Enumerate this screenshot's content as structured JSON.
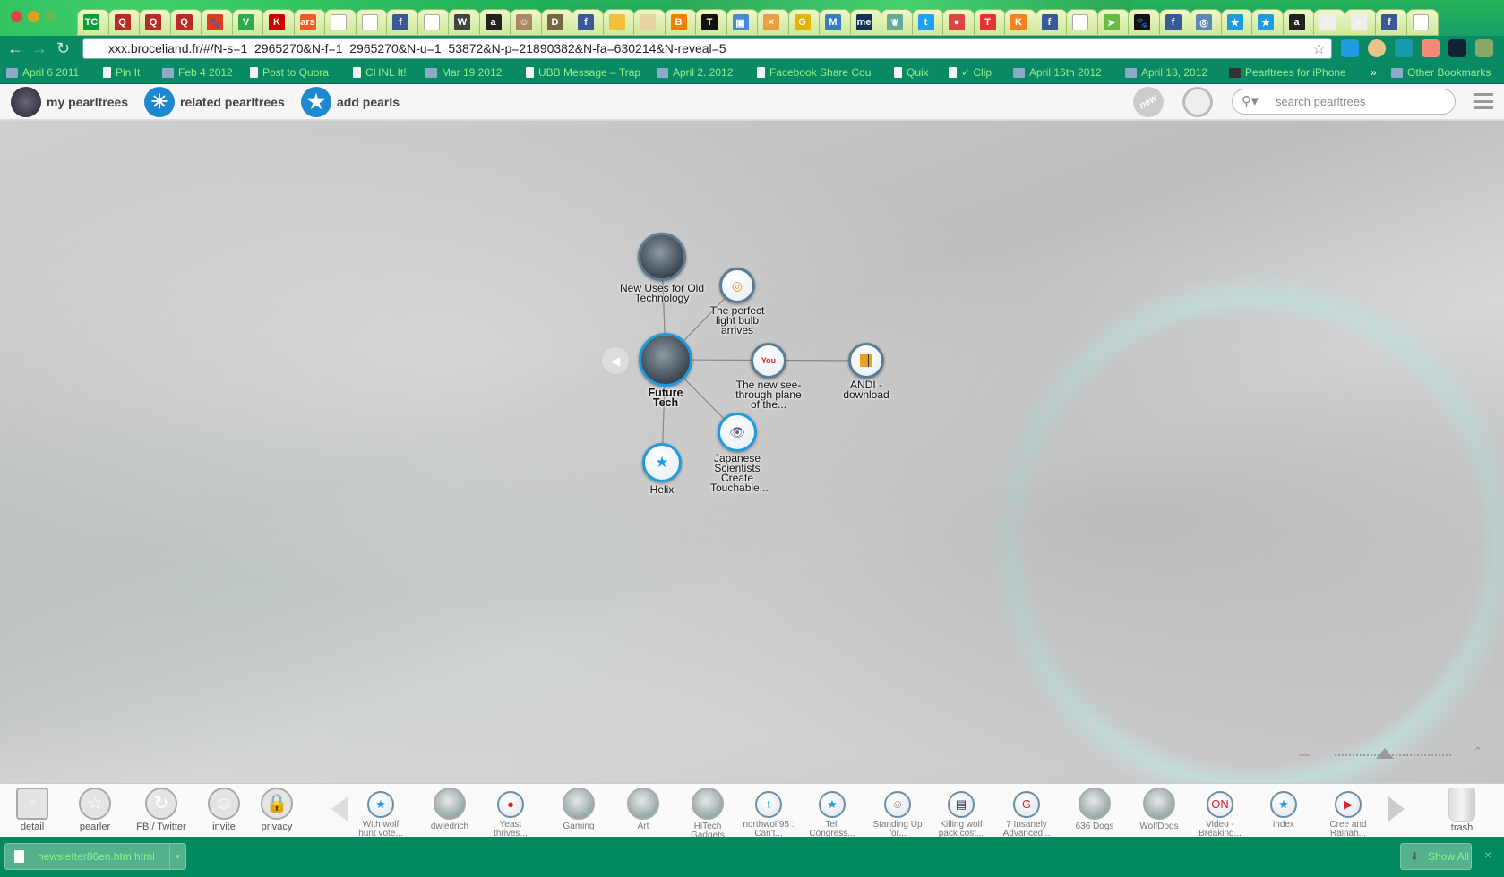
{
  "browser": {
    "tabs": [
      {
        "icon": "TC",
        "color": "#0a9d3a"
      },
      {
        "icon": "Q",
        "color": "#b92b27"
      },
      {
        "icon": "Q",
        "color": "#b92b27"
      },
      {
        "icon": "Q",
        "color": "#b92b27"
      },
      {
        "icon": "paw",
        "color": "#e03c1e"
      },
      {
        "icon": "V",
        "color": "#2fa84f"
      },
      {
        "icon": "GK",
        "color": "#c00"
      },
      {
        "icon": "ars",
        "color": "#f35b24"
      },
      {
        "icon": "page",
        "color": "#ddd"
      },
      {
        "icon": "page",
        "color": "#ddd"
      },
      {
        "icon": "f",
        "color": "#3b5998"
      },
      {
        "icon": "page",
        "color": "#ddd"
      },
      {
        "icon": "wolf",
        "color": "#444"
      },
      {
        "icon": "a",
        "color": "#222"
      },
      {
        "icon": "people",
        "color": "#a86"
      },
      {
        "icon": "dog",
        "color": "#764"
      },
      {
        "icon": "f",
        "color": "#3b5998"
      },
      {
        "icon": "box",
        "color": "#f0c040"
      },
      {
        "icon": "map",
        "color": "#e8d4a0"
      },
      {
        "icon": "B",
        "color": "#f57d00"
      },
      {
        "icon": "T",
        "color": "#111"
      },
      {
        "icon": "img",
        "color": "#4a8ad4"
      },
      {
        "icon": "x",
        "color": "#e8a040"
      },
      {
        "icon": "G",
        "color": "#e5b400"
      },
      {
        "icon": "M",
        "color": "#3a7cc0"
      },
      {
        "icon": "me",
        "color": "#113355"
      },
      {
        "icon": "leaf",
        "color": "#6a9"
      },
      {
        "icon": "bird",
        "color": "#1da1f2"
      },
      {
        "icon": "chrome",
        "color": "#d44"
      },
      {
        "icon": "T",
        "color": "#e8322d"
      },
      {
        "icon": "K",
        "color": "#f58220"
      },
      {
        "icon": "f",
        "color": "#3b5998"
      },
      {
        "icon": "page",
        "color": "#ddd"
      },
      {
        "icon": "plane",
        "color": "#6b4"
      },
      {
        "icon": "paw",
        "color": "#111"
      },
      {
        "icon": "f",
        "color": "#3b5998"
      },
      {
        "icon": "circle",
        "color": "#5a8ab4"
      },
      {
        "icon": "star",
        "color": "#1e9be0"
      },
      {
        "icon": "star",
        "color": "#1e9be0"
      },
      {
        "icon": "a",
        "color": "#222"
      },
      {
        "icon": "o",
        "color": "#eee"
      },
      {
        "icon": "o",
        "color": "#eee"
      },
      {
        "icon": "f",
        "color": "#3b5998"
      },
      {
        "icon": "page",
        "color": "#ddd"
      }
    ],
    "url": "xxx.broceliand.fr/#/N-s=1_2965270&N-f=1_2965270&N-u=1_53872&N-p=21890382&N-fa=630214&N-reveal=5",
    "bookmarks": [
      {
        "label": "April 6 2011",
        "type": "folder"
      },
      {
        "label": "Pin It",
        "type": "page"
      },
      {
        "label": "Feb 4 2012",
        "type": "folder"
      },
      {
        "label": "Post to Quora",
        "type": "page"
      },
      {
        "label": "CHNL It!",
        "type": "page"
      },
      {
        "label": "Mar 19 2012",
        "type": "folder"
      },
      {
        "label": "UBB Message – Trap",
        "type": "page"
      },
      {
        "label": "April 2. 2012",
        "type": "folder"
      },
      {
        "label": "Facebook Share Cou",
        "type": "page"
      },
      {
        "label": "Quix",
        "type": "page"
      },
      {
        "label": "✓ Clip",
        "type": "page"
      },
      {
        "label": "April 16th 2012",
        "type": "folder"
      },
      {
        "label": "April 18, 2012",
        "type": "folder"
      },
      {
        "label": "Pearltrees for iPhone",
        "type": "tg"
      }
    ],
    "overflow": "»",
    "other_bookmarks": "Other Bookmarks"
  },
  "header": {
    "my_pearltrees": "my pearltrees",
    "related_pearltrees": "related pearltrees",
    "add_pearls": "add pearls",
    "new_badge": "new",
    "search_placeholder": "search pearltrees"
  },
  "map": {
    "center": {
      "label1": "Future",
      "label2": "Tech"
    },
    "nodes": [
      {
        "label": "New Uses for Old Technology",
        "icon": "photo"
      },
      {
        "label": "The perfect light bulb arrives",
        "icon": "spiral"
      },
      {
        "label": "The new see-through plane of the...",
        "icon": "youtube"
      },
      {
        "label": "ANDI - download",
        "icon": "grid"
      },
      {
        "label": "Japanese Scientists Create Touchable...",
        "icon": "eye"
      },
      {
        "label": "Helix",
        "icon": "star"
      }
    ]
  },
  "dock": {
    "tools": [
      {
        "label": "detail",
        "icon": "detail-icon"
      },
      {
        "label": "pearler",
        "icon": "pearler-icon"
      },
      {
        "label": "FB / Twitter",
        "icon": "sync-icon"
      },
      {
        "label": "invite",
        "icon": "people-icon"
      },
      {
        "label": "privacy",
        "icon": "lock-icon"
      }
    ],
    "pearls": [
      {
        "label": "With wolf hunt vote...",
        "icon": "★",
        "color": "#1e9be0"
      },
      {
        "label": "dwiedrich",
        "icon": "photo",
        "color": "#999"
      },
      {
        "label": "Yeast thrives...",
        "icon": "●",
        "color": "#d22"
      },
      {
        "label": "Gaming",
        "icon": "photo",
        "color": "#8aa"
      },
      {
        "label": "Art",
        "icon": "photo",
        "color": "#c8a"
      },
      {
        "label": "HiTech Gadgets",
        "icon": "photo",
        "color": "#aaa"
      },
      {
        "label": "northwolf95 : Can't...",
        "icon": "t",
        "color": "#33c3f0"
      },
      {
        "label": "Tell Congress...",
        "icon": "★",
        "color": "#1e9be0"
      },
      {
        "label": "Standing Up for...",
        "icon": "☺",
        "color": "#a77"
      },
      {
        "label": "Killing wolf pack cost...",
        "icon": "▤",
        "color": "#224"
      },
      {
        "label": "7 Insanely Advanced...",
        "icon": "G",
        "color": "#d22"
      },
      {
        "label": "636 Dogs",
        "icon": "photo",
        "color": "#ccc"
      },
      {
        "label": "WolfDogs",
        "icon": "photo",
        "color": "#998"
      },
      {
        "label": "Video - Breaking...",
        "icon": "ON",
        "color": "#d22"
      },
      {
        "label": "index",
        "icon": "★",
        "color": "#1e9be0"
      },
      {
        "label": "Cree and Rainah...",
        "icon": "▶",
        "color": "#d22"
      }
    ],
    "trash": "trash"
  },
  "downloads": {
    "file": "newsletter86en.htm.html",
    "show_all": "Show All",
    "close": "×"
  }
}
